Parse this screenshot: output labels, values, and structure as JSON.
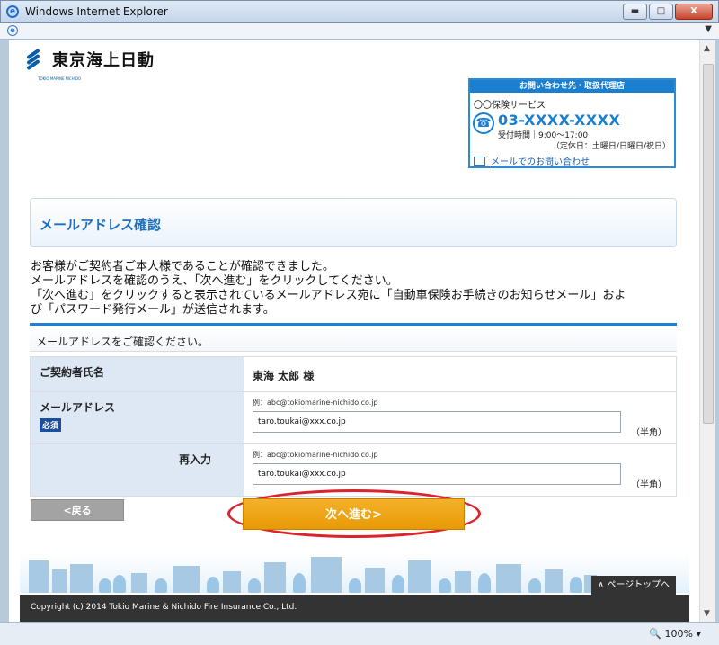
{
  "window": {
    "title": "Windows Internet Explorer",
    "minimize_glyph": "▬",
    "maximize_glyph": "□",
    "close_glyph": "X",
    "menu_glyph": "▼"
  },
  "statusbar": {
    "zoom": "100%"
  },
  "logo": {
    "text": "東京海上日動",
    "sub": "TOKIO MARINE NICHIDO"
  },
  "contact": {
    "heading": "お問い合わせ先・取扱代理店",
    "agency": "〇〇保険サービス",
    "phone": "03-XXXX-XXXX",
    "hours": "受付時間｜9:00～17:00",
    "holidays": "（定休日：土曜日/日曜日/祝日）",
    "mail_link": "メールでのお問い合わせ"
  },
  "page": {
    "title": "メールアドレス確認",
    "message_lines": [
      "お客様がご契約者ご本人様であることが確認できました。",
      "メールアドレスを確認のうえ、「次へ進む」をクリックしてください。",
      "「次へ進む」をクリックすると表示されているメールアドレス宛に「自動車保険お手続きのお知らせメール」およ",
      "び「パスワード発行メール」が送信されます。"
    ],
    "form_instruction": "メールアドレスをご確認ください。"
  },
  "form": {
    "name_label": "ご契約者氏名",
    "name_value": "東海 太郎 様",
    "email_label": "メールアドレス",
    "required_badge": "必須",
    "reenter_label": "再入力",
    "example": "例：abc@tokiomarine-nichido.co.jp",
    "email_value": "taro.toukai@xxx.co.jp",
    "email_confirm_value": "taro.toukai@xxx.co.jp",
    "half_width_note": "（半角）"
  },
  "buttons": {
    "back": "<戻る",
    "next": "次へ進む>",
    "page_top": "∧ ページトップへ"
  },
  "footer": {
    "copyright": "Copyright (c) 2014 Tokio Marine & Nichido Fire Insurance Co., Ltd."
  },
  "colors": {
    "accent_blue": "#1a7ed1",
    "next_button": "#f0a915",
    "highlight": "#d9232d"
  }
}
